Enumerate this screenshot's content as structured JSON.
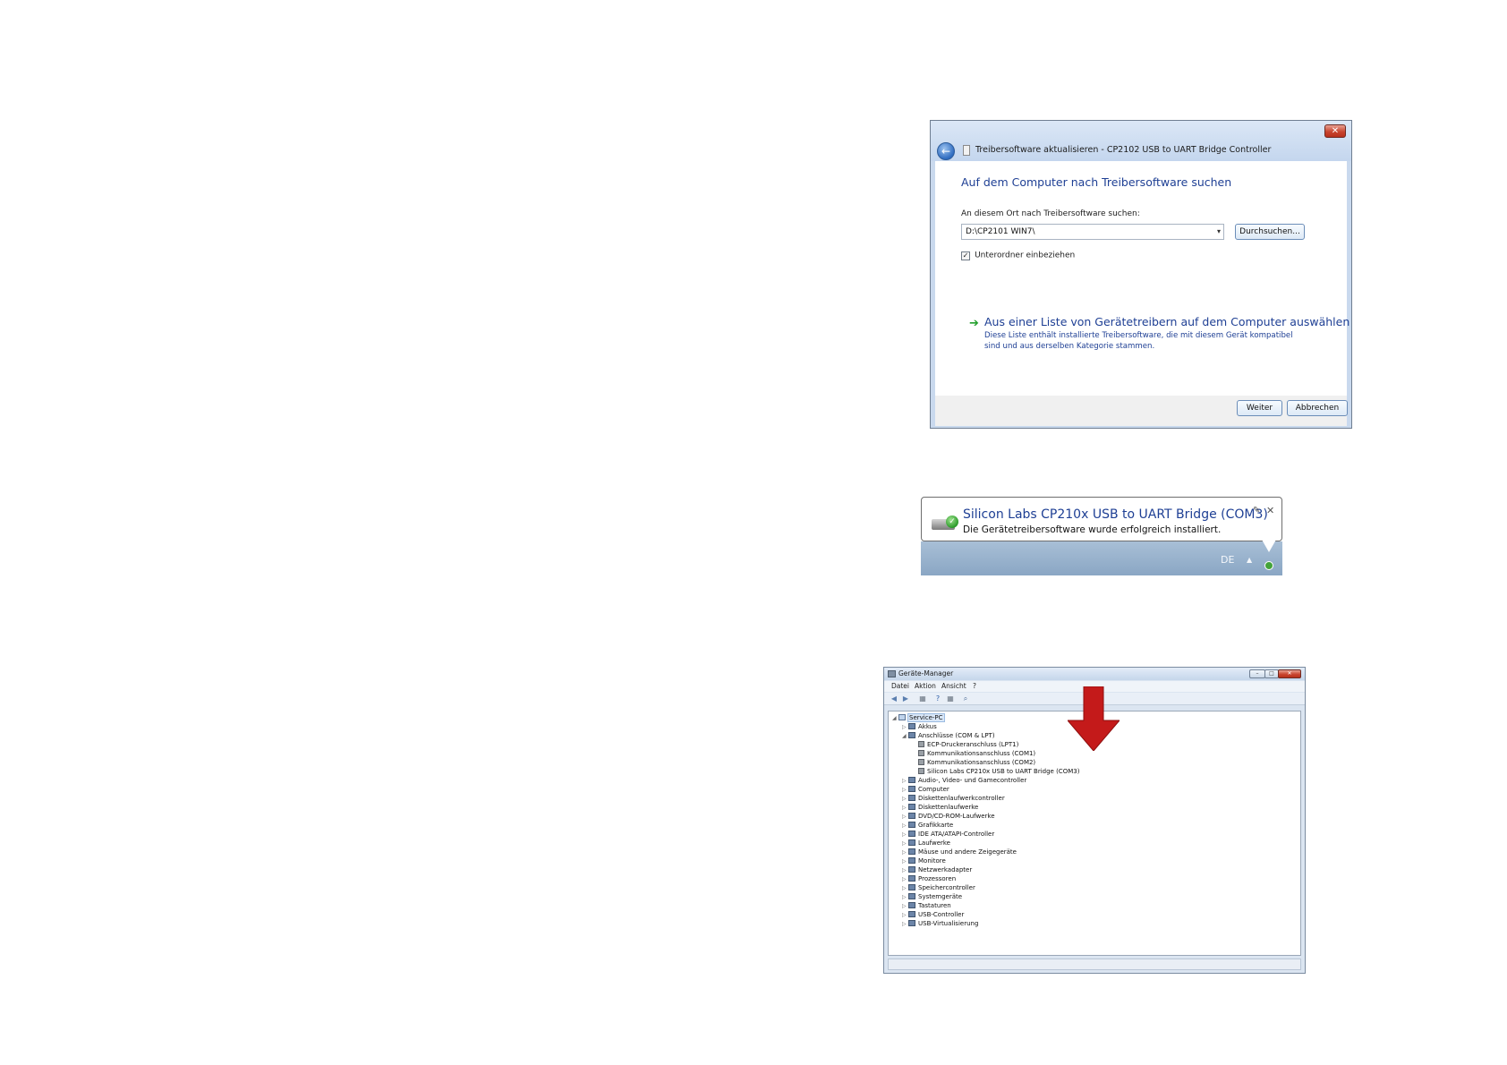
{
  "wizard": {
    "close_label": "✕",
    "back_label": "←",
    "window_title": "Treibersoftware aktualisieren - CP2102 USB to UART Bridge Controller",
    "heading": "Auf dem Computer nach Treibersoftware suchen",
    "location_label": "An diesem Ort nach Treibersoftware suchen:",
    "path_value": "D:\\CP2101 WIN7\\",
    "browse_label": "Durchsuchen...",
    "include_subfolders_label": "Unterordner einbeziehen",
    "include_subfolders_checked": true,
    "check_mark": "✓",
    "list_option_title": "Aus einer Liste von Gerätetreibern auf dem Computer auswählen",
    "list_option_desc": "Diese Liste enthält installierte Treibersoftware, die mit diesem Gerät kompatibel sind und aus derselben Kategorie stammen.",
    "next_label": "Weiter",
    "cancel_label": "Abbrechen"
  },
  "balloon": {
    "title": "Silicon Labs CP210x USB to UART Bridge (COM3)",
    "message": "Die Gerätetreibersoftware wurde erfolgreich installiert.",
    "check_glyph": "✓",
    "pin_glyph": "✎",
    "close_glyph": "✕",
    "taskbar_language": "DE",
    "tray_expand_glyph": "▲"
  },
  "device_manager": {
    "window_title": "Geräte-Manager",
    "window_buttons": {
      "minimize": "–",
      "maximize": "□",
      "close": "✕"
    },
    "menu": [
      "Datei",
      "Aktion",
      "Ansicht",
      "?"
    ],
    "toolbar_icons": [
      "back-icon",
      "forward-icon",
      "properties-icon",
      "help-icon",
      "view-icon",
      "scan-hardware-icon"
    ],
    "tree": [
      {
        "label": "Service-PC",
        "level": 0,
        "expanded": true,
        "selected": true,
        "kind": "root"
      },
      {
        "label": "Akkus",
        "level": 1,
        "expanded": false,
        "kind": "cat"
      },
      {
        "label": "Anschlüsse (COM & LPT)",
        "level": 1,
        "expanded": true,
        "kind": "cat"
      },
      {
        "label": "ECP-Druckeranschluss (LPT1)",
        "level": 2,
        "kind": "port"
      },
      {
        "label": "Kommunikationsanschluss (COM1)",
        "level": 2,
        "kind": "port"
      },
      {
        "label": "Kommunikationsanschluss (COM2)",
        "level": 2,
        "kind": "port"
      },
      {
        "label": "Silicon Labs CP210x USB to UART Bridge (COM3)",
        "level": 2,
        "kind": "port"
      },
      {
        "label": "Audio-, Video- und Gamecontroller",
        "level": 1,
        "expanded": false,
        "kind": "cat"
      },
      {
        "label": "Computer",
        "level": 1,
        "expanded": false,
        "kind": "cat"
      },
      {
        "label": "Diskettenlaufwerkcontroller",
        "level": 1,
        "expanded": false,
        "kind": "cat"
      },
      {
        "label": "Diskettenlaufwerke",
        "level": 1,
        "expanded": false,
        "kind": "cat"
      },
      {
        "label": "DVD/CD-ROM-Laufwerke",
        "level": 1,
        "expanded": false,
        "kind": "cat"
      },
      {
        "label": "Grafikkarte",
        "level": 1,
        "expanded": false,
        "kind": "cat"
      },
      {
        "label": "IDE ATA/ATAPI-Controller",
        "level": 1,
        "expanded": false,
        "kind": "cat"
      },
      {
        "label": "Laufwerke",
        "level": 1,
        "expanded": false,
        "kind": "cat"
      },
      {
        "label": "Mäuse und andere Zeigegeräte",
        "level": 1,
        "expanded": false,
        "kind": "cat"
      },
      {
        "label": "Monitore",
        "level": 1,
        "expanded": false,
        "kind": "cat"
      },
      {
        "label": "Netzwerkadapter",
        "level": 1,
        "expanded": false,
        "kind": "cat"
      },
      {
        "label": "Prozessoren",
        "level": 1,
        "expanded": false,
        "kind": "cat"
      },
      {
        "label": "Speichercontroller",
        "level": 1,
        "expanded": false,
        "kind": "cat"
      },
      {
        "label": "Systemgeräte",
        "level": 1,
        "expanded": false,
        "kind": "cat"
      },
      {
        "label": "Tastaturen",
        "level": 1,
        "expanded": false,
        "kind": "cat"
      },
      {
        "label": "USB-Controller",
        "level": 1,
        "expanded": false,
        "kind": "cat"
      },
      {
        "label": "USB-Virtualisierung",
        "level": 1,
        "expanded": false,
        "kind": "cat"
      }
    ]
  },
  "colors": {
    "accent_link": "#1e3f94",
    "arrow_red": "#c41a1a",
    "success_green": "#2b9a2a"
  }
}
